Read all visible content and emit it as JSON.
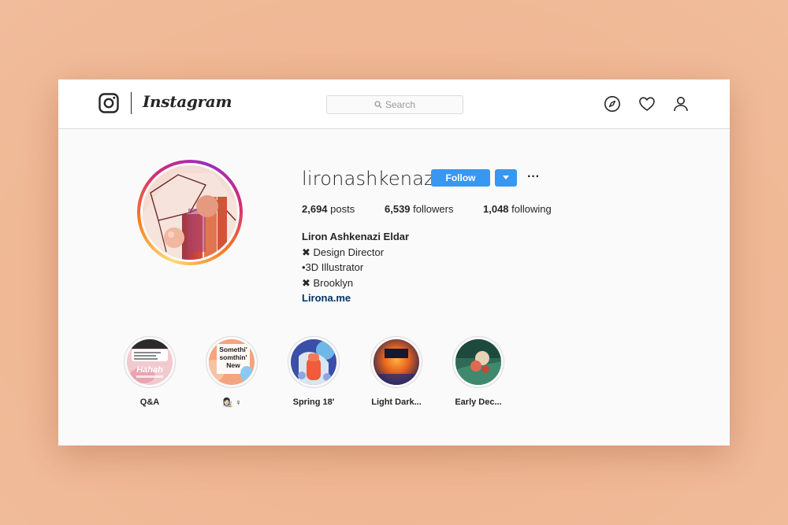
{
  "app": {
    "wordmark": "Instagram"
  },
  "search": {
    "placeholder": "Search"
  },
  "nav": {
    "icons": [
      "explore-icon",
      "heart-icon",
      "profile-icon"
    ]
  },
  "profile": {
    "username": "lironashkenazi",
    "follow_label": "Follow",
    "more_label": "···",
    "stats": {
      "posts_value": "2,694",
      "posts_label": "posts",
      "followers_value": "6,539",
      "followers_label": "followers",
      "following_value": "1,048",
      "following_label": "following"
    },
    "bio": {
      "name": "Liron Ashkenazi Eldar",
      "line1": "✖  Design Director",
      "line2": "•3D Illustrator",
      "line3": "✖  Brooklyn",
      "link": "Lirona.me"
    }
  },
  "highlights": [
    {
      "label": "Q&A",
      "art_text": "Hahah"
    },
    {
      "label": "👩🏻‍🎨 ♀",
      "art_text": "Somethi' somthin' New"
    },
    {
      "label": "Spring 18'"
    },
    {
      "label": "Light Dark..."
    },
    {
      "label": "Early Dec..."
    }
  ],
  "colors": {
    "accent": "#3897f0",
    "link": "#003569",
    "background": "#fafafa",
    "border": "#dbdbdb",
    "text": "#262626"
  }
}
